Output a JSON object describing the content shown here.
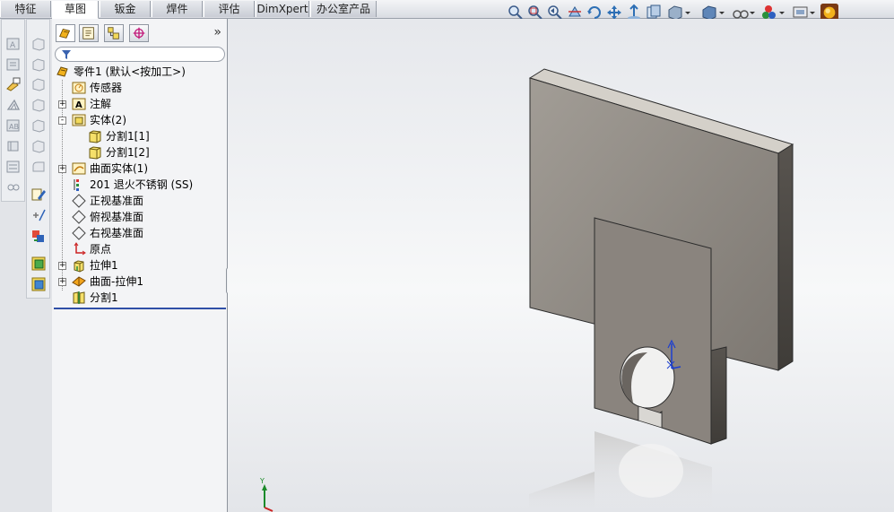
{
  "command_tabs": [
    {
      "label": "特征"
    },
    {
      "label": "草图"
    },
    {
      "label": "钣金"
    },
    {
      "label": "焊件"
    },
    {
      "label": "评估"
    },
    {
      "label": "DimXpert"
    },
    {
      "label": "办公室产品"
    }
  ],
  "active_tab": "草图",
  "view_toolbar_icons": [
    "zoom-to-fit-icon",
    "zoom-to-area-icon",
    "previous-view-icon",
    "section-view-icon",
    "rotate-icon",
    "pan-icon",
    "normal-to-icon",
    "view-orientation-icon",
    "display-style-icon",
    "hide-show-icon",
    "appearance-icon",
    "scene-icon",
    "view-settings-icon",
    "realview-icon"
  ],
  "feature_tree": {
    "root": {
      "label": "零件1 (默认<按加工>)"
    },
    "items": [
      {
        "label": "传感器",
        "icon": "sensor-icon"
      },
      {
        "label": "注解",
        "icon": "annotation-icon",
        "expander": "+"
      },
      {
        "label": "实体(2)",
        "icon": "solid-bodies-icon",
        "expander": "-"
      },
      {
        "label": "分割1[1]",
        "icon": "body-icon"
      },
      {
        "label": "分割1[2]",
        "icon": "body-icon"
      },
      {
        "label": "曲面实体(1)",
        "icon": "surface-bodies-icon",
        "expander": "+"
      },
      {
        "label": "201 退火不锈钢 (SS)",
        "icon": "material-icon"
      },
      {
        "label": "正视基准面",
        "icon": "plane-icon"
      },
      {
        "label": "俯视基准面",
        "icon": "plane-icon"
      },
      {
        "label": "右视基准面",
        "icon": "plane-icon"
      },
      {
        "label": "原点",
        "icon": "origin-icon"
      },
      {
        "label": "拉伸1",
        "icon": "extrude-icon",
        "expander": "+"
      },
      {
        "label": "曲面-拉伸1",
        "icon": "surface-extrude-icon",
        "expander": "+"
      },
      {
        "label": "分割1",
        "icon": "split-icon"
      }
    ]
  },
  "triad": {
    "y_label": "Y"
  },
  "colors": {
    "accent": "#2f4fa6",
    "model_face": "#8a8580",
    "model_top": "#c9c5be"
  }
}
